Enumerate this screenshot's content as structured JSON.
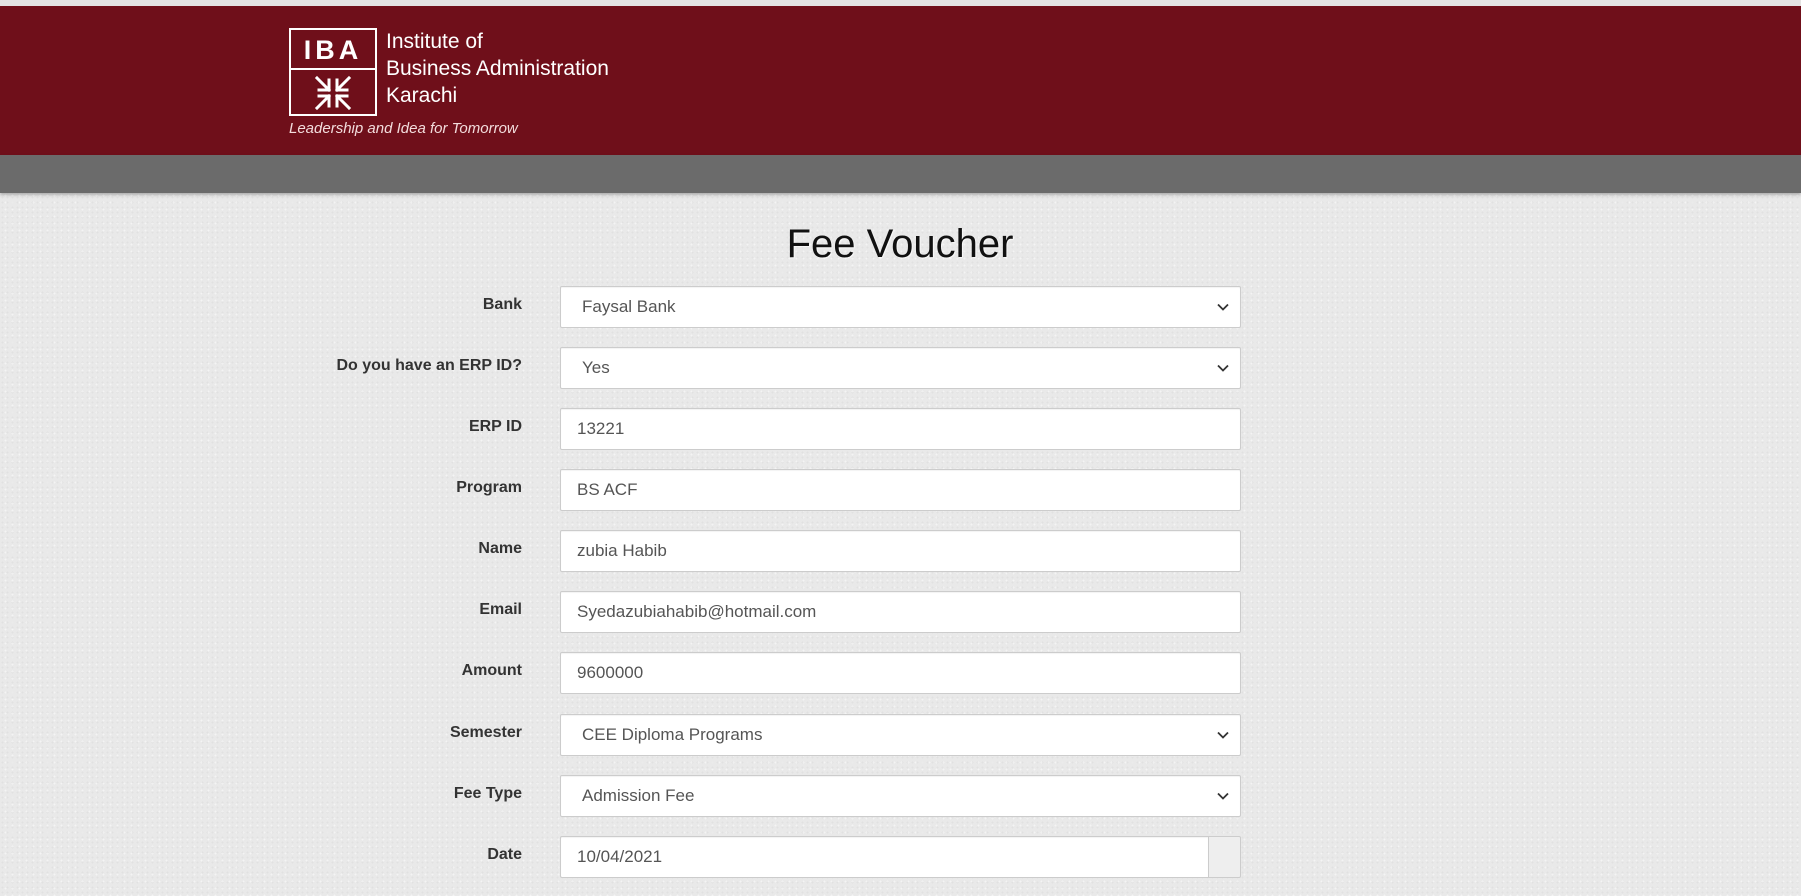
{
  "header": {
    "logo_text": "IBA",
    "institute_lines": [
      "Institute of",
      "Business Administration",
      "Karachi"
    ],
    "tagline": "Leadership and Idea for Tomorrow",
    "brand_color": "#6f0f1a",
    "nav_color": "#6b6b6b"
  },
  "page": {
    "title": "Fee Voucher"
  },
  "form": {
    "bank": {
      "label": "Bank",
      "value": "Faysal Bank"
    },
    "has_erp": {
      "label": "Do you have an ERP ID?",
      "value": "Yes"
    },
    "erp_id": {
      "label": "ERP ID",
      "value": "13221"
    },
    "program": {
      "label": "Program",
      "value": "BS ACF"
    },
    "name": {
      "label": "Name",
      "value": "zubia Habib"
    },
    "email": {
      "label": "Email",
      "value": "Syedazubiahabib@hotmail.com"
    },
    "amount": {
      "label": "Amount",
      "value": "9600000"
    },
    "semester": {
      "label": "Semester",
      "value": "CEE Diploma Programs"
    },
    "fee_type": {
      "label": "Fee Type",
      "value": "Admission Fee"
    },
    "date": {
      "label": "Date",
      "value": "10/04/2021"
    }
  }
}
